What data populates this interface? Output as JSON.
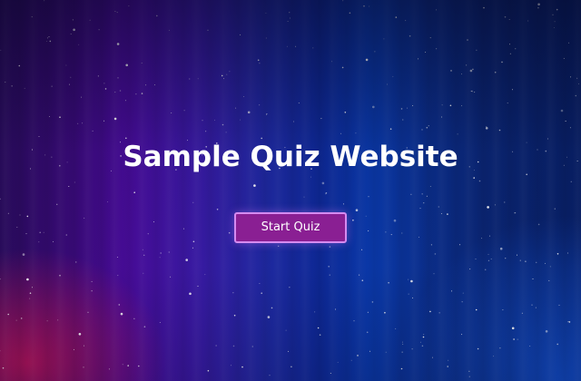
{
  "hero": {
    "title": "Sample Quiz Website",
    "start_button_label": "Start Quiz"
  },
  "colors": {
    "button_bg": "#8a1f93",
    "button_border": "#d58af0",
    "title_text": "#ffffff"
  }
}
